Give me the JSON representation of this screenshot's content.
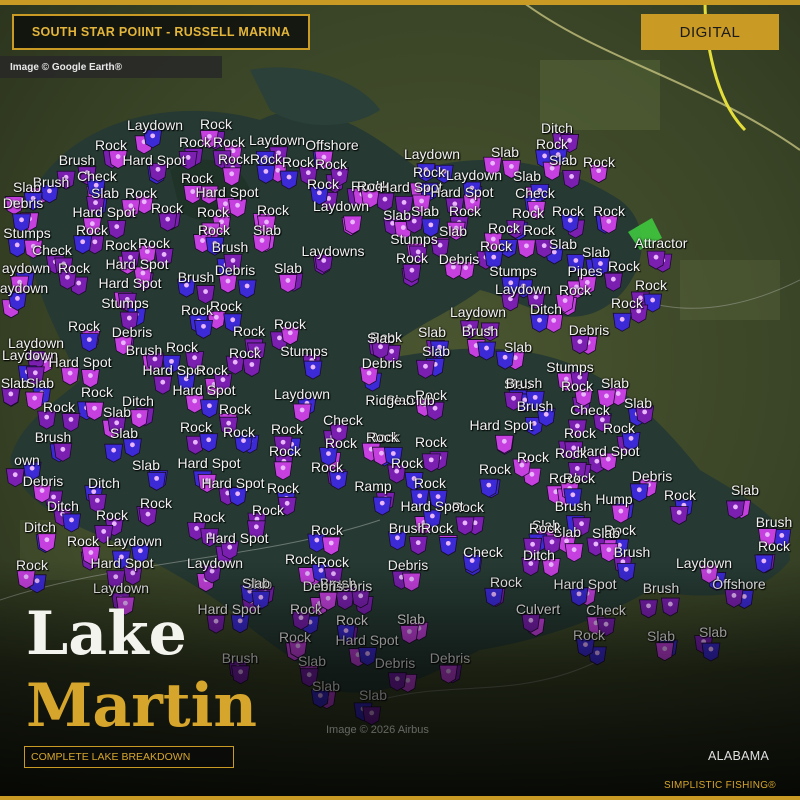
{
  "header": {
    "location": "SOUTH STAR POIINT - RUSSELL MARINA",
    "badge": "DIGITAL",
    "image_credit": "Image © Google Earth®"
  },
  "footer": {
    "title_line1": "Lake",
    "title_line2": "Martin",
    "subtitle": "COMPLETE LAKE BREAKDOWN",
    "state": "ALABAMA",
    "brand": "SIMPLISTIC FISHING®",
    "imagery_credit": "Image © 2026 Airbus"
  },
  "colors": {
    "gold": "#c99a24",
    "marker_purple": "#7a1fb0",
    "marker_magenta": "#c640e0",
    "marker_blue": "#3b2ad6",
    "land": "#3a4527",
    "water": "#263a33"
  },
  "map_labels": [
    "Rock",
    "Laydown",
    "Rock",
    "Laydown",
    "Offshore",
    "Ditch",
    "Rock",
    "Brush",
    "Hard Spot",
    "Rock",
    "Rock",
    "Rock",
    "Laydown",
    "Slab",
    "Rock",
    "Brush",
    "Check",
    "Rock",
    "Rock",
    "Slab",
    "Rock",
    "Slab",
    "Rock",
    "Slab",
    "Rock",
    "Rock",
    "Hard Spot",
    "Rock",
    "Laydown",
    "Slab",
    "Check",
    "Debris",
    "Hard Spot",
    "Rock",
    "Rock",
    "Hard Spot",
    "Rock",
    "Rock",
    "Slab",
    "Hard Spot",
    "Rock",
    "Rock",
    "Laydown",
    "Slab",
    "Rock",
    "Rock",
    "Rock",
    "Stumps",
    "Rock",
    "Rock",
    "Rock",
    "Brush",
    "Slab",
    "Stumps",
    "Slab",
    "Rock",
    "Slab",
    "Attractor",
    "Check",
    "Rock",
    "Rock",
    "Laydowns",
    "Rock",
    "Slab",
    "aydown",
    "Rock",
    "Hard Spot",
    "Debris",
    "Slab",
    "Rock",
    "Debris",
    "Stumps",
    "Pipes",
    "Rock",
    "aydown",
    "Hard Spot",
    "Brush",
    "Laydown",
    "Rock",
    "Rock",
    "Stumps",
    "Rock",
    "Laydown",
    "Ditch",
    "Rock",
    "Rock",
    "Rock",
    "Rock",
    "Debris",
    "Debris",
    "Rock",
    "Rock",
    "Laydown",
    "Slab",
    "Slab",
    "Brush",
    "Laydown",
    "Rock",
    "Brush",
    "Stumps",
    "Slab",
    "Debris",
    "Hard Spot",
    "Rock",
    "Slab",
    "Stumps",
    "Hard Spot",
    "Rock",
    "Slab",
    "Brush",
    "Rock",
    "e Slab",
    "Hard Spot",
    "Laydown",
    "Slab",
    "Rock",
    "Slab",
    "Brush",
    "Check",
    "Slab",
    "Slab",
    "Ditch",
    "Rock",
    "Rock",
    "Rock",
    "Rock",
    "Rock",
    "Check",
    "Rock",
    "Rock",
    "Hard Spot",
    "Rock",
    "Brush",
    "Slab",
    "Rock",
    "Rock",
    "Rock",
    "Rock",
    "Rock",
    "Rock",
    "Hard Spot",
    "own",
    "Slab",
    "Hard Spot",
    "Rock",
    "Rock",
    "Rock",
    "Rock",
    "Rock",
    "Debris",
    "Debris",
    "Ditch",
    "Hard Spot",
    "Rock",
    "Ramp",
    "Rock",
    "Rock",
    "Rock",
    "Hump",
    "Slab",
    "Ditch",
    "Rock",
    "Rock",
    "Rock",
    "Hard Spot",
    "Brush",
    "Rock",
    "Ditch",
    "Rock",
    "Rock",
    "Brush",
    "Slab",
    "Slab",
    "Rock",
    "Brush",
    "Rock",
    "Laydown",
    "Hard Spot",
    "Rock",
    "Rock",
    "Rock",
    "Slab",
    "Rock",
    "Hard Spot",
    "Laydown",
    "Rock",
    "Debris",
    "Check",
    "Ditch",
    "Brush",
    "Laydown",
    "Brush",
    "Debris",
    "Slab",
    "Hard Spot",
    "Offshore",
    "Laydown",
    "Slab",
    "Debris",
    "Rock",
    "Brush",
    "Hard Spot",
    "Rock",
    "Rock",
    "Culvert",
    "Check",
    "Slab",
    "Rock",
    "Rock",
    "Hard Spot",
    "Slab",
    "Slab",
    "Brush",
    "Slab",
    "Debris",
    "Debris",
    "Slab",
    "Slab",
    "Rock",
    "Slab",
    "Ridge Club"
  ]
}
